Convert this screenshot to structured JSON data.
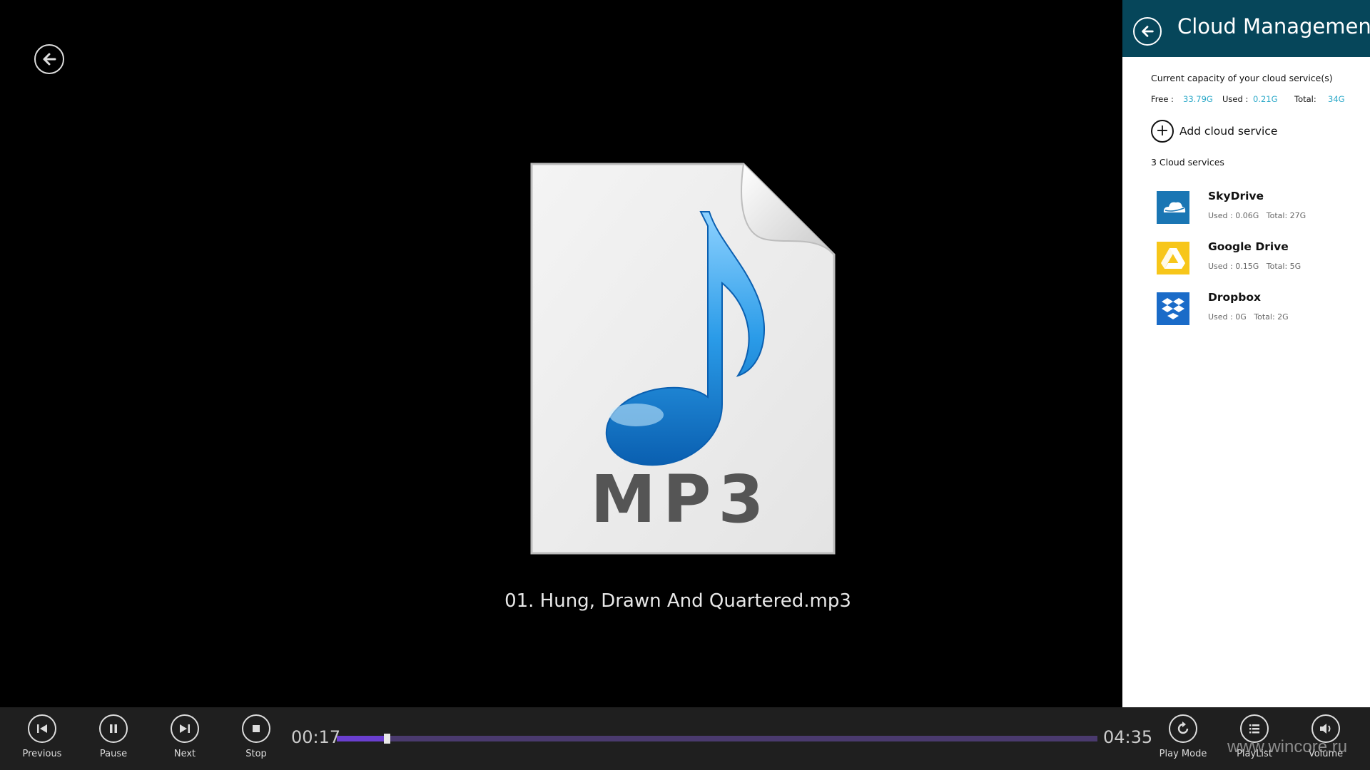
{
  "player": {
    "track_title": "01. Hung, Drawn And Quartered.mp3",
    "file_badge": "MP3",
    "current_time": "00:17",
    "total_time": "04:35",
    "progress_fraction": 0.062,
    "accent_color": "#6a3fcf"
  },
  "controls": {
    "previous": "Previous",
    "pause": "Pause",
    "next": "Next",
    "stop": "Stop",
    "play_mode": "Play Mode",
    "playlist": "PlayList",
    "volume": "Volume"
  },
  "panel": {
    "title": "Cloud Management",
    "header_color": "#06465a",
    "capacity_label": "Current capacity of your cloud service(s)",
    "free_key": "Free :",
    "free_val": "33.79G",
    "used_key": "Used :",
    "used_val": "0.21G",
    "total_key": "Total:",
    "total_val": "34G",
    "add_label": "Add cloud service",
    "count_label": "3 Cloud services",
    "services": [
      {
        "name": "SkyDrive",
        "used": "Used :  0.06G",
        "total": "Total: 27G",
        "icon": "skydrive-icon",
        "color": "#1a76b4"
      },
      {
        "name": "Google Drive",
        "used": "Used :  0.15G",
        "total": "Total: 5G",
        "icon": "google-drive-icon",
        "color": "#f7c61a"
      },
      {
        "name": "Dropbox",
        "used": "Used :  0G",
        "total": "Total: 2G",
        "icon": "dropbox-icon",
        "color": "#1a6bc8"
      }
    ]
  },
  "watermark": "www.wincore.ru"
}
